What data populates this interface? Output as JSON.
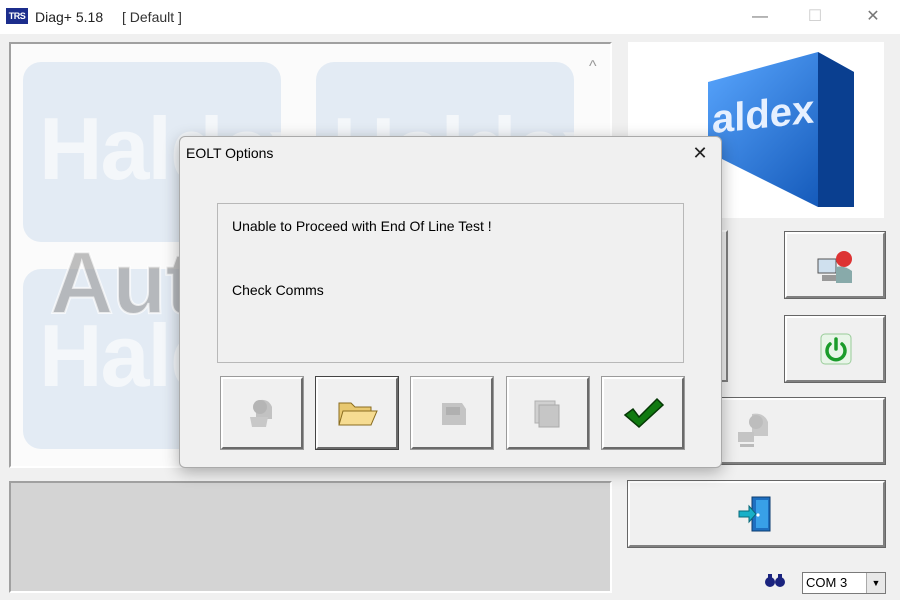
{
  "window": {
    "logo_text": "TRS",
    "title": "Diag+ 5.18",
    "profile": "[ Default ]",
    "minimize_label": "—",
    "maximize_label": "☐",
    "close_label": "✕"
  },
  "background_logo_text": "Haldex",
  "brand_logo_text": "aldex",
  "watermark": "AutoSoft.Group",
  "dialog": {
    "title": "EOLT Options",
    "close_label": "✕",
    "message_line1": "Unable to Proceed with End Of Line Test !",
    "message_line2": "Check Comms",
    "buttons": [
      {
        "icon": "ecu-head-icon",
        "enabled": false
      },
      {
        "icon": "folder-icon",
        "enabled": true
      },
      {
        "icon": "ecu-module-icon",
        "enabled": false
      },
      {
        "icon": "stacked-pages-icon",
        "enabled": false
      },
      {
        "icon": "checkmark-icon",
        "enabled": true
      }
    ]
  },
  "side_buttons": [
    {
      "icon": "diagnostic-person-icon",
      "enabled": true
    },
    {
      "icon": "power-icon",
      "enabled": true,
      "color": "#1a9c2a"
    },
    {
      "icon": "ecu-connect-icon",
      "enabled": false
    },
    {
      "icon": "exit-door-icon",
      "enabled": true
    }
  ],
  "port": {
    "selected": "COM 3",
    "arrow": "▼"
  },
  "colors": {
    "haldex_blue": "#1f6fd0",
    "check_green": "#107a10"
  }
}
